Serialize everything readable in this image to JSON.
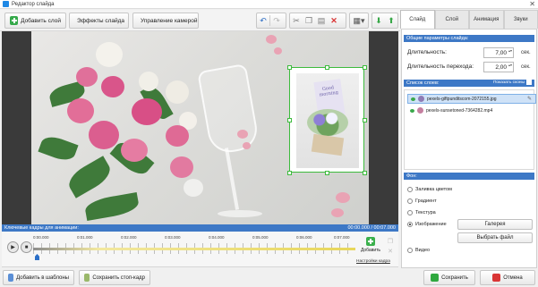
{
  "window": {
    "title": "Редактор слайда"
  },
  "toolbar": {
    "add_layer": "Добавить слой",
    "slide_effects": "Эффекты слайда",
    "camera_control": "Управление камерой"
  },
  "keyframes": {
    "header": "Ключевые кадры для анимации:",
    "time_range": "00:00.000 / 00:07.000",
    "ticks": [
      "0:00.000",
      "0:01.000",
      "0:02.000",
      "0:03.000",
      "0:04.000",
      "0:05.000",
      "0:06.000",
      "0:07.000"
    ],
    "add_label": "Добавить",
    "settings_link": "Настройки кадра"
  },
  "bottom": {
    "add_to_templates": "Добавить в шаблоны",
    "save_still": "Сохранить стоп-кадр",
    "save": "Сохранить",
    "cancel": "Отмена"
  },
  "tabs": [
    "Слайд",
    "Слой",
    "Анимация",
    "Звуки"
  ],
  "general": {
    "header": "Общие параметры слайда:",
    "duration_label": "Длительность:",
    "duration_value": "7,00",
    "transition_label": "Длительность перехода:",
    "transition_value": "2,00",
    "unit": "сек."
  },
  "layers": {
    "header": "Список слоев:",
    "show_all": "Показать сконы",
    "items": [
      {
        "name": "pexels-giftpunditscom-2072155.jpg",
        "selected": true
      },
      {
        "name": "pexels-sunsetoned-7364282.mp4",
        "selected": false
      }
    ]
  },
  "background": {
    "header": "Фон:",
    "options": [
      "Заливка цветом",
      "Градиент",
      "Текстура",
      "Изображение",
      "Видео"
    ],
    "selected": "Изображение",
    "gallery_button": "Галерея",
    "choose_file_button": "Выбрать файл"
  },
  "colors": {
    "accent": "#3d78c6",
    "handle": "#3dbb3d",
    "ok": "#2fa83f",
    "cancel": "#d93535"
  }
}
